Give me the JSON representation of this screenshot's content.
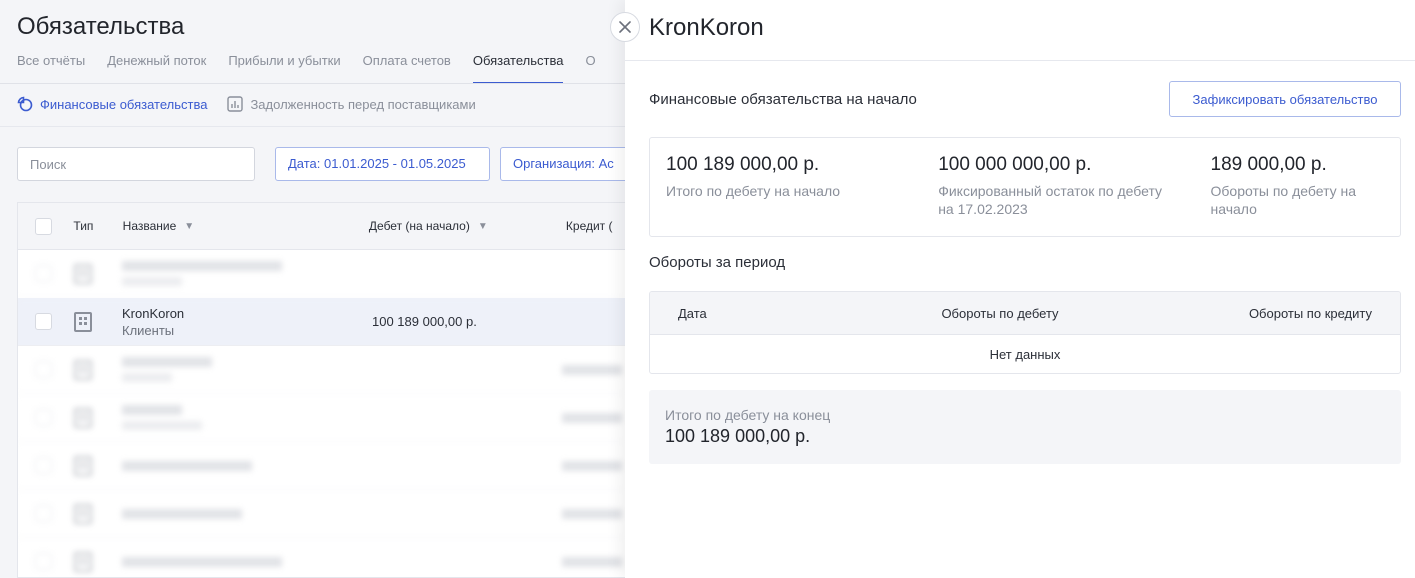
{
  "page": {
    "title": "Обязательства",
    "tabs": [
      "Все отчёты",
      "Денежный поток",
      "Прибыли и убытки",
      "Оплата счетов",
      "Обязательства",
      "О"
    ],
    "active_tab_index": 4,
    "subtabs": [
      "Финансовые обязательства",
      "Задолженность перед поставщиками"
    ],
    "search_placeholder": "Поиск",
    "filter_date": "Дата: 01.01.2025 - 01.05.2025",
    "filter_org": "Организация: Ас",
    "table": {
      "headers": {
        "type": "Тип",
        "name": "Название",
        "debit": "Дебет (на начало)",
        "credit": "Кредит ("
      },
      "selected_row": {
        "name": "KronKoron",
        "type": "Клиенты",
        "debit": "100 189 000,00 р."
      }
    }
  },
  "panel": {
    "title": "KronKoron",
    "close_icon": "close-icon",
    "section_start_title": "Финансовые обязательства на начало",
    "fix_button": "Зафиксировать обязательство",
    "summary": [
      {
        "amount": "100 189 000,00 р.",
        "label": "Итого по дебету на начало"
      },
      {
        "amount": "100 000 000,00 р.",
        "label": "Фиксированный остаток по дебету на 17.02.2023"
      },
      {
        "amount": "189 000,00 р.",
        "label": "Обороты по дебету на начало"
      }
    ],
    "section_period_title": "Обороты за период",
    "period_table": {
      "headers": [
        "Дата",
        "Обороты по дебету",
        "Обороты по кредиту"
      ],
      "empty_text": "Нет данных"
    },
    "totals": {
      "label": "Итого по дебету на конец",
      "amount": "100 189 000,00 р."
    }
  },
  "colors": {
    "accent": "#3b5bd0",
    "muted": "#8a8f9a",
    "panel_bg": "#f4f5f8"
  }
}
